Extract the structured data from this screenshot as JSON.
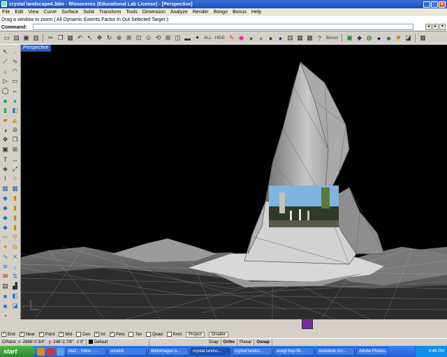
{
  "window": {
    "title": "crystal landscape4.3dm - Rhinoceros (Educational Lab License) - [Perspective]",
    "min": "_",
    "max": "□",
    "close": "×"
  },
  "menu": [
    "File",
    "Edit",
    "View",
    "Curve",
    "Surface",
    "Solid",
    "Transform",
    "Tools",
    "Dimension",
    "Analyze",
    "Render",
    "Bongo",
    "Bonus",
    "Help"
  ],
  "command": {
    "history": "Drag a window to zoom ( All  Dynamic  Extents  Factor  In  Out  Selected  Target ):",
    "label": "Command:",
    "value": ""
  },
  "toolbar": {
    "all": "ALL",
    "hide": "HIDE",
    "bonus": "Bonus"
  },
  "viewport": {
    "name": "Perspective"
  },
  "osnap": {
    "items": [
      {
        "label": "End",
        "checked": true
      },
      {
        "label": "Near",
        "checked": true
      },
      {
        "label": "Point",
        "checked": true
      },
      {
        "label": "Mid",
        "checked": true
      },
      {
        "label": "Cen",
        "checked": false
      },
      {
        "label": "Int",
        "checked": true
      },
      {
        "label": "Perp",
        "checked": true
      },
      {
        "label": "Tan",
        "checked": false
      },
      {
        "label": "Quad",
        "checked": false
      },
      {
        "label": "Knot",
        "checked": false
      }
    ],
    "project": "Project",
    "disable": "Disable"
  },
  "status": {
    "cplane": "CPlane",
    "x": "x -2686'-0 3/4\"",
    "y": "y -248'-2 7/8\"",
    "z": "z 0\"",
    "layer": "Default",
    "snap": "Snap",
    "ortho": "Ortho",
    "planar": "Planar",
    "osnap": "Osnap"
  },
  "taskbar": {
    "start": "start",
    "tasks": [
      "Mail :: Inbox - ...",
      "scratch",
      "WebImages o...",
      "crystal landsc...",
      "crystal landsc...",
      "assgt 6sp.06-...",
      "Autodesk Arc...",
      "Adobe Photos..."
    ],
    "clock": "4:49 PM"
  },
  "colors": {
    "titlebar": "#1d4fc0",
    "viewport_bg": "#000000",
    "taskbar": "#245edb",
    "start": "#2d8a2d"
  }
}
